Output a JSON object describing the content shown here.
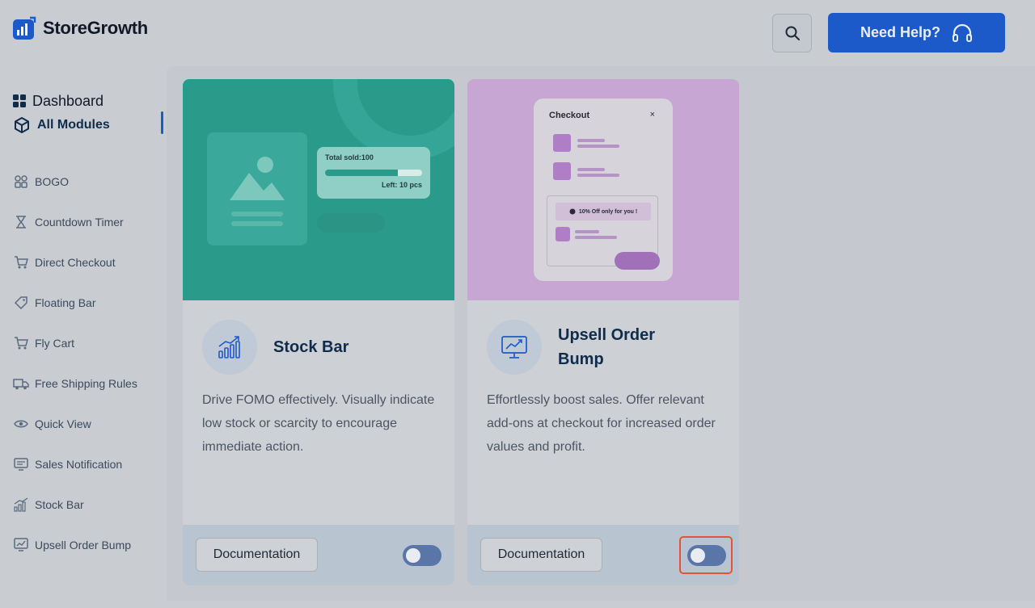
{
  "header": {
    "brand": "StoreGrowth",
    "help_label": "Need Help?"
  },
  "sidebar": {
    "main": [
      {
        "label": "Dashboard",
        "icon": "grid-icon"
      },
      {
        "label": "All Modules",
        "icon": "cube-icon",
        "active": true
      }
    ],
    "modules": [
      {
        "label": "BOGO",
        "icon": "bogo-icon"
      },
      {
        "label": "Countdown Timer",
        "icon": "hourglass-icon"
      },
      {
        "label": "Direct Checkout",
        "icon": "cart-icon"
      },
      {
        "label": "Floating Bar",
        "icon": "tag-icon"
      },
      {
        "label": "Fly Cart",
        "icon": "cart-icon"
      },
      {
        "label": "Free Shipping Rules",
        "icon": "truck-icon"
      },
      {
        "label": "Quick View",
        "icon": "eye-icon"
      },
      {
        "label": "Sales Notification",
        "icon": "notification-icon"
      },
      {
        "label": "Stock Bar",
        "icon": "bar-chart-icon"
      },
      {
        "label": "Upsell Order Bump",
        "icon": "upsell-icon"
      }
    ]
  },
  "cards": [
    {
      "title": "Stock Bar",
      "description": "Drive FOMO effectively. Visually indicate low stock or scarcity to encourage immediate action.",
      "doc_label": "Documentation",
      "enabled": false,
      "banner": {
        "total_sold": "Total sold:100",
        "left": "Left: 10 pcs",
        "progress": 0.75
      }
    },
    {
      "title": "Upsell Order Bump",
      "description": "Effortlessly boost sales. Offer relevant add-ons at checkout for increased order values and profit.",
      "doc_label": "Documentation",
      "enabled": false,
      "banner": {
        "checkout": "Checkout",
        "close": "×",
        "offer": "10% Off only for you !"
      }
    }
  ],
  "colors": {
    "primary": "#1c5ac9",
    "stock_banner": "#2a9a8a",
    "upsell_banner": "#c8a6d4",
    "highlight": "#e0553a"
  }
}
